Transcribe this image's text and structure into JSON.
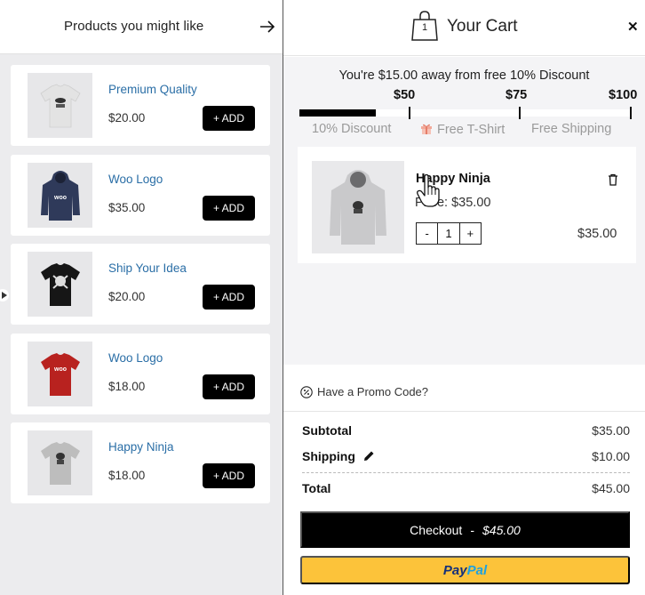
{
  "suggestions": {
    "title": "Products you might like",
    "products": [
      {
        "name": "Premium Quality",
        "price": "$20.00",
        "add_label": "+ ADD",
        "color": "#e3e3e3"
      },
      {
        "name": "Woo Logo",
        "price": "$35.00",
        "add_label": "+ ADD",
        "color": "#2f3a5a"
      },
      {
        "name": "Ship Your Idea",
        "price": "$20.00",
        "add_label": "+ ADD",
        "color": "#161616"
      },
      {
        "name": "Woo Logo",
        "price": "$18.00",
        "add_label": "+ ADD",
        "color": "#b8221f"
      },
      {
        "name": "Happy Ninja",
        "price": "$18.00",
        "add_label": "+ ADD",
        "color": "#bdbdbd"
      }
    ]
  },
  "cart": {
    "title": "Your Cart",
    "count": "1",
    "away_message": "You're $15.00 away from free 10% Discount",
    "progress_fraction": 0.23,
    "milestones": [
      {
        "value": "$50",
        "label": "10% Discount"
      },
      {
        "value": "$75",
        "label": "Free T-Shirt"
      },
      {
        "value": "$100",
        "label": "Free Shipping"
      }
    ],
    "item": {
      "name": "Happy Ninja",
      "price_line": "Price: $35.00",
      "quantity": "1",
      "minus": "-",
      "plus": "+",
      "total": "$35.00"
    },
    "promo_label": "Have a Promo Code?",
    "subtotal_label": "Subtotal",
    "subtotal": "$35.00",
    "shipping_label": "Shipping",
    "shipping": "$10.00",
    "total_label": "Total",
    "total": "$45.00",
    "checkout_label": "Checkout",
    "checkout_sep": "-",
    "checkout_amount": "$45.00",
    "paypal_pay": "Pay",
    "paypal_pal": "Pal"
  },
  "colors": {
    "accent": "#000000",
    "link": "#2a6ea6",
    "paypal": "#fcc33a"
  }
}
